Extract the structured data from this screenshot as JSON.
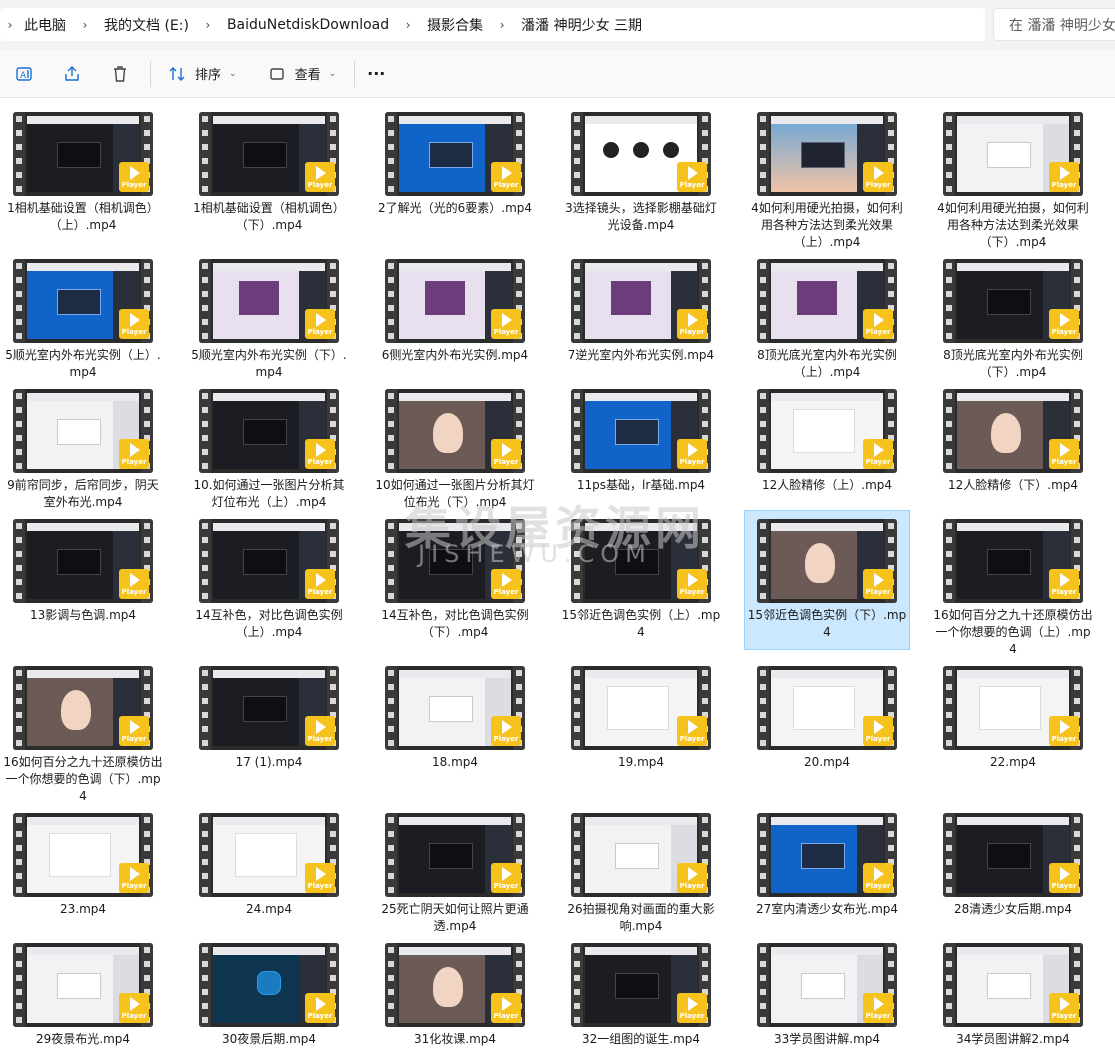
{
  "address": {
    "crumbs": [
      "此电脑",
      "我的文档 (E:)",
      "BaiduNetdiskDownload",
      "摄影合集",
      "潘潘 神明少女 三期"
    ],
    "search_placeholder": "在 潘潘 神明少女 三期 中搜索"
  },
  "toolbar": {
    "sort_label": "排序",
    "view_label": "查看",
    "more_label": "···"
  },
  "player_badge": "Player",
  "watermark": {
    "main": "集设屋资源网",
    "sub": "JISHEWU.COM"
  },
  "selected_index": 22,
  "files": [
    {
      "name": "1相机基础设置（相机调色）（上）.mp4",
      "thumb": "dark"
    },
    {
      "name": "1相机基础设置（相机调色）（下）.mp4",
      "thumb": "dark"
    },
    {
      "name": "2了解光（光的6要素）.mp4",
      "thumb": "blue"
    },
    {
      "name": "3选择镜头，选择影棚基础灯光设备.mp4",
      "thumb": "studio"
    },
    {
      "name": "4如何利用硬光拍摄，如何利用各种方法达到柔光效果（上）.mp4",
      "thumb": "sky"
    },
    {
      "name": "4如何利用硬光拍摄，如何利用各种方法达到柔光效果（下）.mp4",
      "thumb": "light"
    },
    {
      "name": "5顺光室内外布光实例（上）.mp4",
      "thumb": "blue"
    },
    {
      "name": "5顺光室内外布光实例（下）.mp4",
      "thumb": "purple"
    },
    {
      "name": "6侧光室内外布光实例.mp4",
      "thumb": "purple"
    },
    {
      "name": "7逆光室内外布光实例.mp4",
      "thumb": "purple"
    },
    {
      "name": "8顶光底光室内外布光实例（上）.mp4",
      "thumb": "purple"
    },
    {
      "name": "8顶光底光室内外布光实例（下）.mp4",
      "thumb": "dark"
    },
    {
      "name": "9前帘同步，后帘同步，阴天室外布光.mp4",
      "thumb": "light"
    },
    {
      "name": "10.如何通过一张图片分析其灯位布光（上）.mp4",
      "thumb": "dark"
    },
    {
      "name": "10如何通过一张图片分析其灯位布光（下）.mp4",
      "thumb": "face"
    },
    {
      "name": "11ps基础，lr基础.mp4",
      "thumb": "blue"
    },
    {
      "name": "12人脸精修（上）.mp4",
      "thumb": "doc"
    },
    {
      "name": "12人脸精修（下）.mp4",
      "thumb": "face"
    },
    {
      "name": "13影调与色调.mp4",
      "thumb": "dark"
    },
    {
      "name": "14互补色，对比色调色实例（上）.mp4",
      "thumb": "dark"
    },
    {
      "name": "14互补色，对比色调色实例（下）.mp4",
      "thumb": "dark"
    },
    {
      "name": "15邻近色调色实例（上）.mp4",
      "thumb": "dark"
    },
    {
      "name": "15邻近色调色实例（下）.mp4",
      "thumb": "face"
    },
    {
      "name": "16如何百分之九十还原模仿出一个你想要的色调（上）.mp4",
      "thumb": "dark"
    },
    {
      "name": "16如何百分之九十还原模仿出一个你想要的色调（下）.mp4",
      "thumb": "face"
    },
    {
      "name": "17 (1).mp4",
      "thumb": "dark"
    },
    {
      "name": "18.mp4",
      "thumb": "light"
    },
    {
      "name": "19.mp4",
      "thumb": "doc"
    },
    {
      "name": "20.mp4",
      "thumb": "doc"
    },
    {
      "name": "22.mp4",
      "thumb": "doc"
    },
    {
      "name": "23.mp4",
      "thumb": "doc"
    },
    {
      "name": "24.mp4",
      "thumb": "doc"
    },
    {
      "name": "25死亡阴天如何让照片更通透.mp4",
      "thumb": "dark"
    },
    {
      "name": "26拍摄视角对画面的重大影响.mp4",
      "thumb": "light"
    },
    {
      "name": "27室内清透少女布光.mp4",
      "thumb": "blue"
    },
    {
      "name": "28清透少女后期.mp4",
      "thumb": "dark"
    },
    {
      "name": "29夜景布光.mp4",
      "thumb": "light"
    },
    {
      "name": "30夜景后期.mp4",
      "thumb": "teal"
    },
    {
      "name": "31化妆课.mp4",
      "thumb": "face"
    },
    {
      "name": "32一组图的诞生.mp4",
      "thumb": "dark"
    },
    {
      "name": "33学员图讲解.mp4",
      "thumb": "light"
    },
    {
      "name": "34学员图讲解2.mp4",
      "thumb": "light"
    }
  ]
}
